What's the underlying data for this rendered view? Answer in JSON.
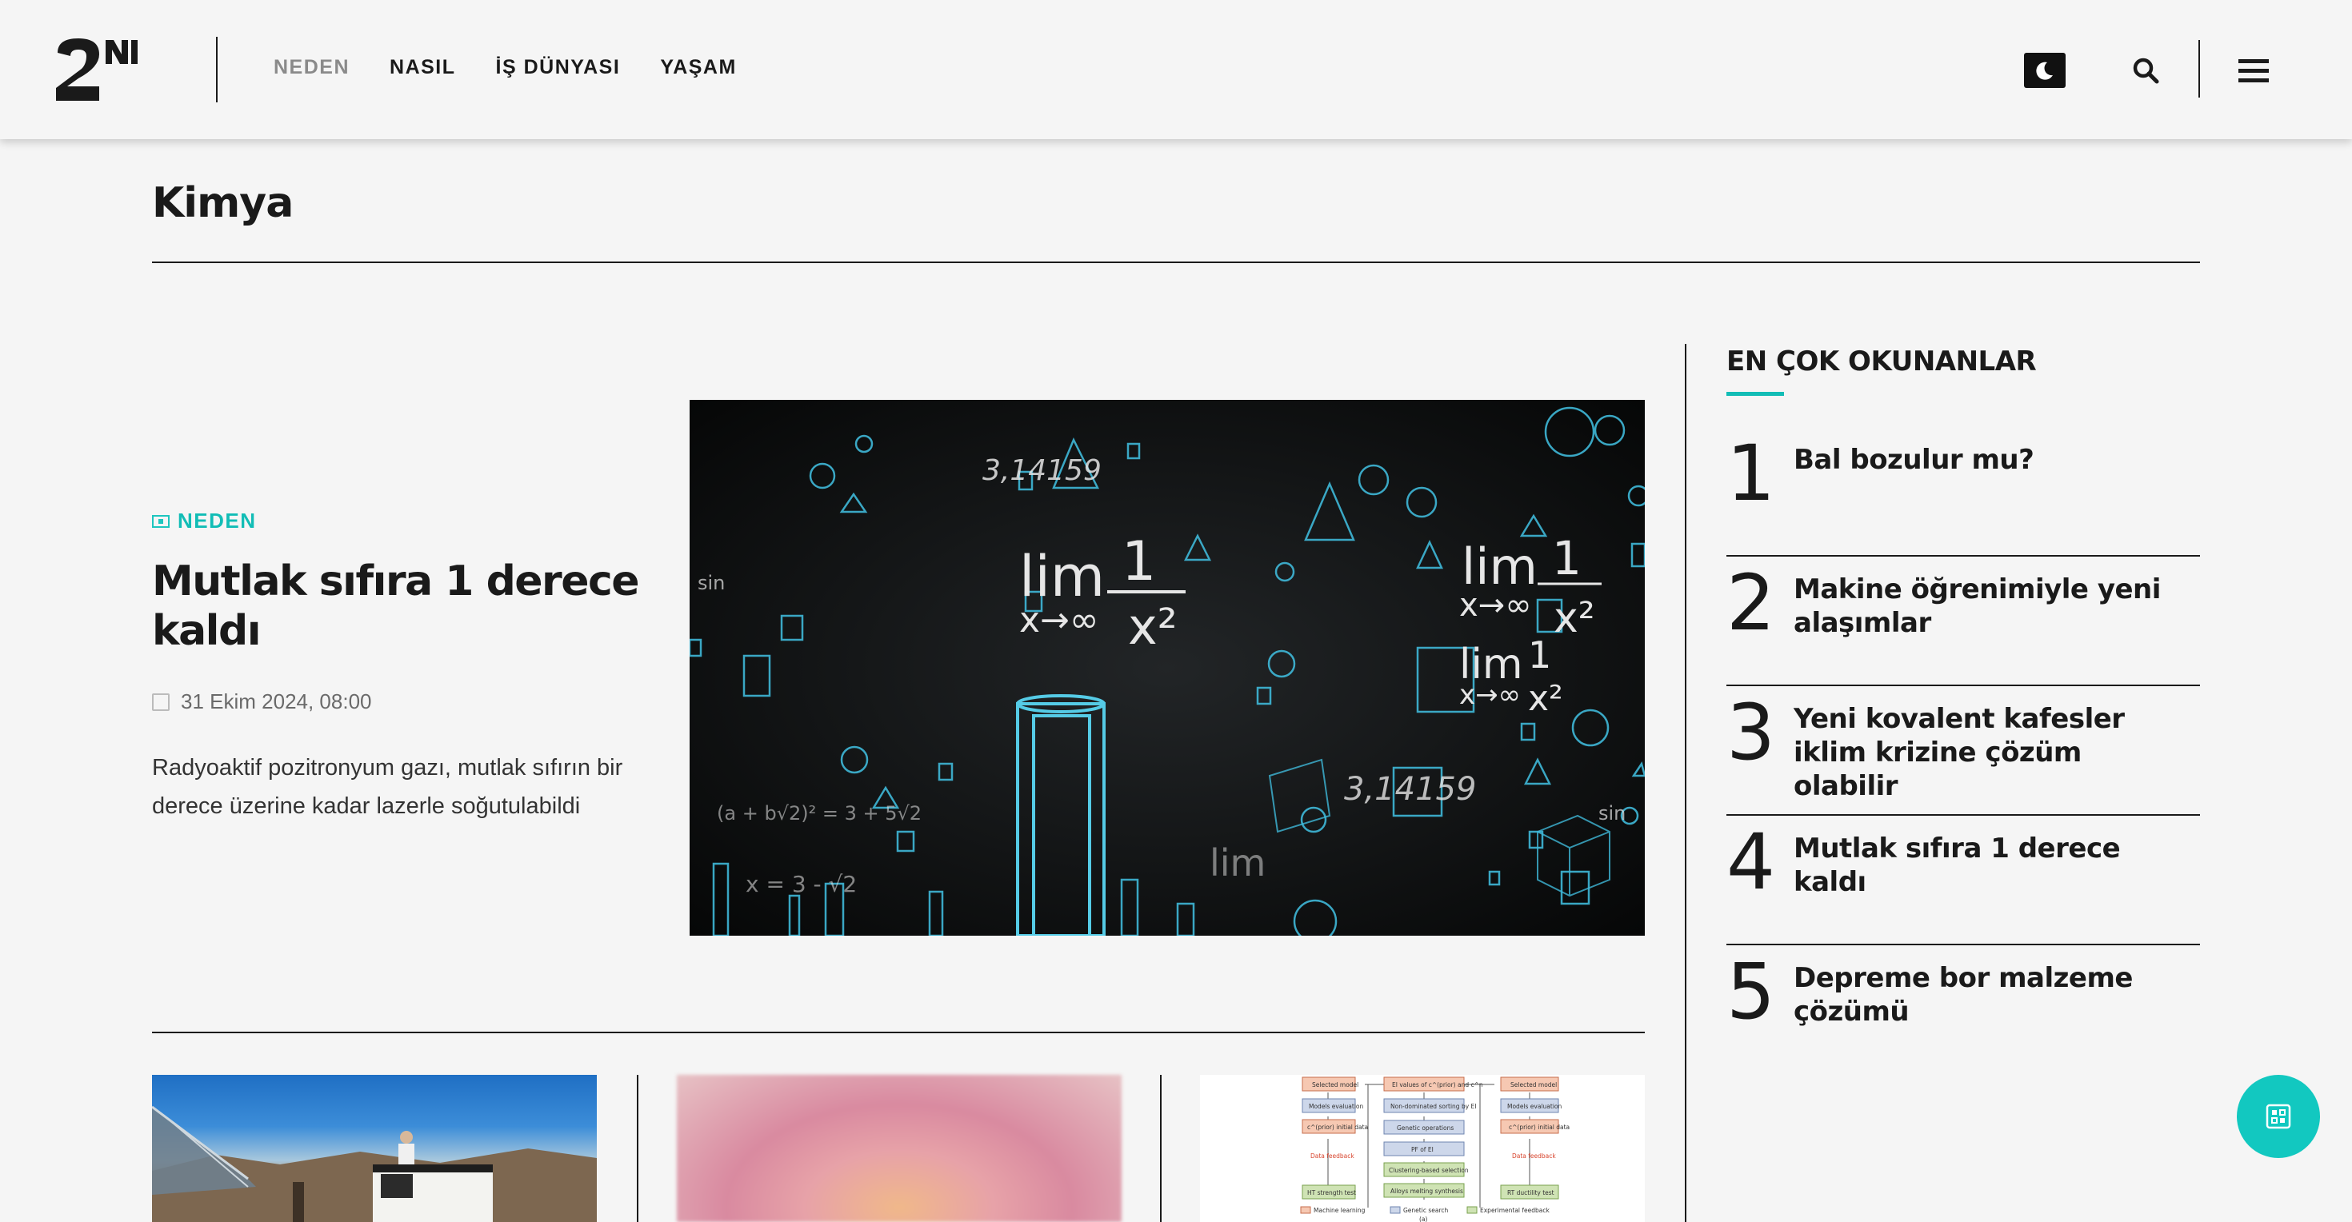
{
  "header": {
    "nav": [
      {
        "label": "NEDEN",
        "active": true
      },
      {
        "label": "NASIL",
        "active": false
      },
      {
        "label": "İŞ DÜNYASI",
        "active": false
      },
      {
        "label": "YAŞAM",
        "active": false
      }
    ],
    "icons": {
      "logo": "2n-logo",
      "theme": "moon-icon",
      "search": "search-icon",
      "menu": "hamburger-icon"
    }
  },
  "page": {
    "title": "Kimya"
  },
  "featured": {
    "category": "NEDEN",
    "title": "Mutlak sıfıra 1 derece kaldı",
    "date": "31 Ekim 2024, 08:00",
    "excerpt": "Radyoaktif pozitronyum gazı, mutlak sıfırın bir derece üzerine kadar lazerle soğutulabildi",
    "image_text": {
      "lim": "lim",
      "one": "1",
      "x_to_inf": "x→∞",
      "x_squared": "x²",
      "pi_value": "3,14159",
      "eq_a": "(a + b√2)² = 3 + 5√2",
      "eq_b": "x = 3 - √2",
      "sin": "sin"
    }
  },
  "sidebar": {
    "title": "EN ÇOK OKUNANLAR",
    "items": [
      {
        "rank": "1",
        "title": "Bal bozulur mu?"
      },
      {
        "rank": "2",
        "title": "Makine öğrenimiyle yeni alaşımlar"
      },
      {
        "rank": "3",
        "title": "Yeni kovalent kafesler iklim krizine çözüm olabilir"
      },
      {
        "rank": "4",
        "title": "Mutlak sıfıra 1 derece kaldı"
      },
      {
        "rank": "5",
        "title": "Depreme bor malzeme çözümü"
      }
    ]
  },
  "cards": {
    "diagram": {
      "selected_model": "Selected model",
      "ei_values": "EI values of c^(prior) and c^n",
      "model_eval": "Models evaluation",
      "non_dominated": "Non-dominated sorting by EI",
      "initial_data": "c^(prior) initial data",
      "genetic_ops": "Genetic operations",
      "pf_ei": "PF of EI",
      "data_feedback": "Data feedback",
      "clustering": "Clustering-based selection",
      "alloys_synth": "Alloys melting synthesis",
      "ht_test": "HT strength test",
      "rt_test": "RT ductility test",
      "legend_ml": "Machine learning",
      "legend_gs": "Genetic search",
      "legend_ef": "Experimental feedback",
      "caption": "(a)"
    }
  },
  "accessibility": {
    "icon": "accessibility-icon"
  }
}
